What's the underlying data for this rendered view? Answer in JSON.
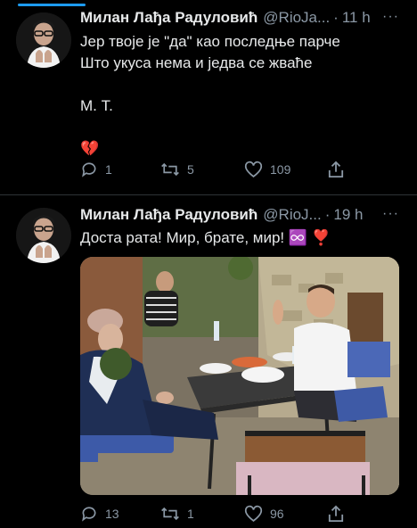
{
  "tweets": [
    {
      "name": "Милан Лађа Радуловић",
      "handle": "@RioJa...",
      "dot": "·",
      "time": "11 h",
      "more": "···",
      "text": "Јер твоје је \"да\" као последње парче\nШто укуса нема и једва се жваће\n\nМ. Т.\n\n💔",
      "replies": "1",
      "retweets": "5",
      "likes": "109"
    },
    {
      "name": "Милан Лађа Радуловић",
      "handle": "@RioJ...",
      "dot": "·",
      "time": "19 h",
      "more": "···",
      "text": "Доста рата! Мир, брате, мир! ♾️ ❣️",
      "replies": "13",
      "retweets": "1",
      "likes": "96"
    }
  ],
  "icons": [
    "reply-icon",
    "retweet-icon",
    "like-icon",
    "share-icon",
    "more-icon"
  ],
  "colors": {
    "background": "#000000",
    "text": "#e7e9ea",
    "secondary": "#8b98a5",
    "accent": "#1d9bf0",
    "divider": "#2f3336"
  }
}
